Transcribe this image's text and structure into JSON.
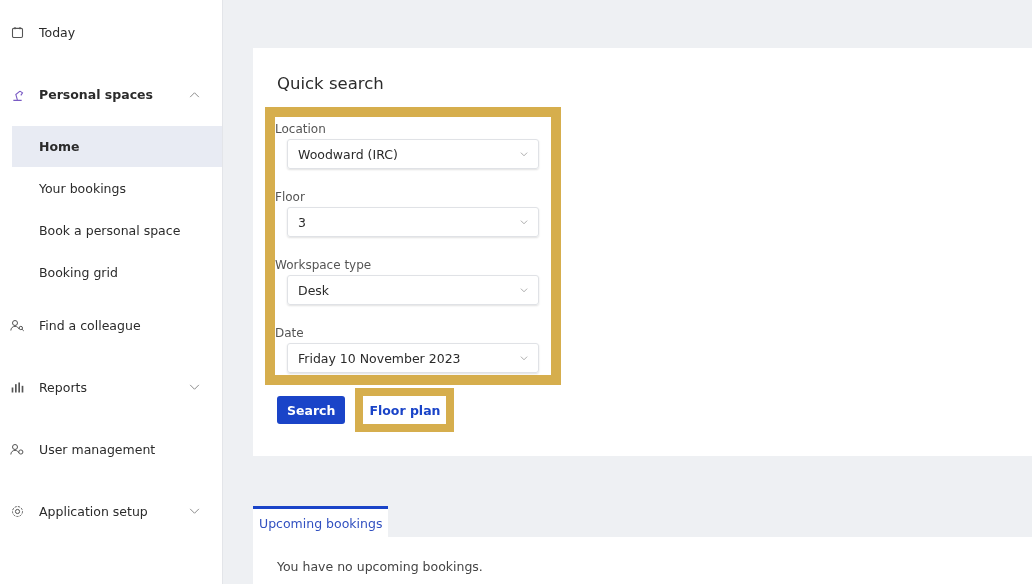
{
  "sidebar": {
    "items": [
      {
        "label": "Today",
        "kind": "link",
        "selected": false
      },
      {
        "label": "Personal spaces",
        "kind": "group",
        "expanded": true,
        "children": [
          {
            "label": "Home",
            "selected": true
          },
          {
            "label": "Your bookings",
            "selected": false
          },
          {
            "label": "Book a personal space",
            "selected": false
          },
          {
            "label": "Booking grid",
            "selected": false
          }
        ]
      },
      {
        "label": "Find a colleague",
        "kind": "link",
        "selected": false
      },
      {
        "label": "Reports",
        "kind": "group",
        "expanded": false
      },
      {
        "label": "User management",
        "kind": "link",
        "selected": false
      },
      {
        "label": "Application setup",
        "kind": "group",
        "expanded": false
      }
    ]
  },
  "quick_search": {
    "title": "Quick search",
    "highlighted": true,
    "fields": [
      {
        "label": "Location",
        "value": "Woodward (IRC)"
      },
      {
        "label": "Floor",
        "value": "3"
      },
      {
        "label": "Workspace type",
        "value": "Desk"
      },
      {
        "label": "Date",
        "value": "Friday 10 November 2023"
      }
    ],
    "buttons": [
      {
        "label": "Search",
        "kind": "primary",
        "highlighted": false
      },
      {
        "label": "Floor plan",
        "kind": "link",
        "highlighted": true
      }
    ]
  },
  "tabs": [
    {
      "label": "Upcoming bookings",
      "selected": true
    }
  ],
  "message": "You have no upcoming bookings."
}
